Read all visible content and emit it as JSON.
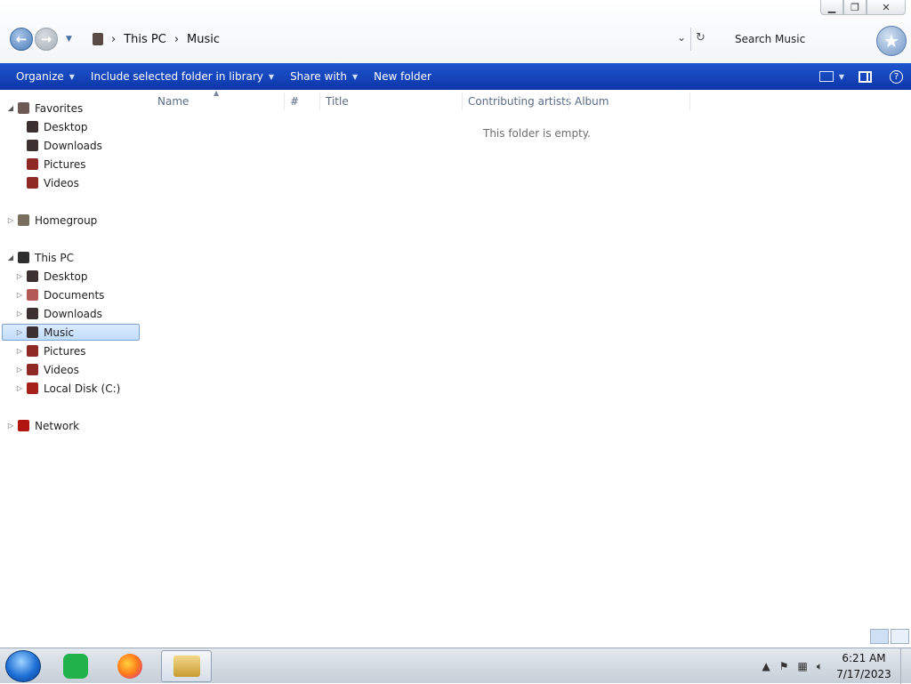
{
  "window": {
    "caption": {
      "minimize": "▁",
      "restore": "❐",
      "close": "✕"
    },
    "address": {
      "crumbs": [
        "This PC",
        "Music"
      ]
    },
    "search_placeholder": "Search Music"
  },
  "commandbar": {
    "organize": "Organize",
    "include": "Include selected folder in library",
    "share": "Share with",
    "new_folder": "New folder",
    "help": "?"
  },
  "navpane": {
    "favorites": {
      "label": "Favorites",
      "items": [
        "Desktop",
        "Downloads",
        "Pictures",
        "Videos"
      ]
    },
    "homegroup": "Homegroup",
    "this_pc": {
      "label": "This PC",
      "items": [
        "Desktop",
        "Documents",
        "Downloads",
        "Music",
        "Pictures",
        "Videos",
        "Local Disk (C:)"
      ]
    },
    "network": "Network"
  },
  "content": {
    "columns": [
      "Name",
      "#",
      "Title",
      "Contributing artists",
      "Album"
    ],
    "empty_message": "This folder is empty."
  },
  "taskbar": {
    "time": "6:21 AM",
    "date": "7/17/2023"
  }
}
